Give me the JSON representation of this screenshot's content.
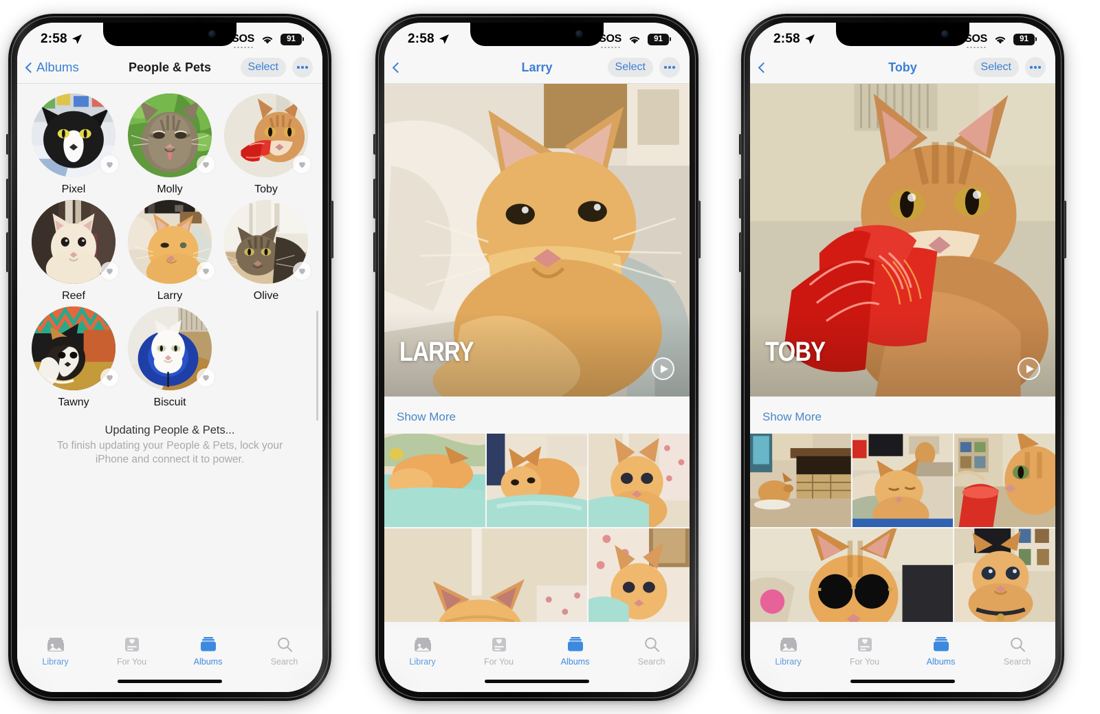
{
  "status_bar": {
    "time": "2:58",
    "sos": "SOS",
    "battery": "91",
    "location_icon": "location-arrow-icon",
    "wifi_icon": "wifi-icon"
  },
  "phones": [
    {
      "id": "phone-people-and-pets",
      "nav": {
        "back_label": "Albums",
        "title": "People & Pets",
        "title_is_link": false,
        "select_label": "Select",
        "more_label": "•••"
      },
      "pets": [
        {
          "name": "Pixel",
          "favorite_icon": "heart-icon"
        },
        {
          "name": "Molly",
          "favorite_icon": "heart-icon"
        },
        {
          "name": "Toby",
          "favorite_icon": "heart-icon"
        },
        {
          "name": "Reef",
          "favorite_icon": "heart-icon"
        },
        {
          "name": "Larry",
          "favorite_icon": "heart-icon"
        },
        {
          "name": "Olive",
          "favorite_icon": "heart-icon"
        },
        {
          "name": "Tawny",
          "favorite_icon": "heart-icon"
        },
        {
          "name": "Biscuit",
          "favorite_icon": "heart-icon"
        }
      ],
      "status": {
        "title": "Updating People & Pets...",
        "subtitle": "To finish updating your People & Pets, lock your iPhone and connect it to power."
      }
    },
    {
      "id": "phone-larry",
      "nav": {
        "back_label": "",
        "title": "Larry",
        "title_is_link": true,
        "select_label": "Select",
        "more_label": "•••"
      },
      "hero": {
        "overlay_title": "LARRY",
        "play_icon": "play-circle-icon"
      },
      "show_more": "Show More",
      "thumbnails": [
        {
          "name": "kitten-sleeping-with-toys"
        },
        {
          "name": "kitten-on-teal-blanket"
        },
        {
          "name": "kitten-sitting-upright"
        },
        {
          "name": "kitten-close-up-ears"
        },
        {
          "name": "kitten-on-floral-blanket"
        }
      ]
    },
    {
      "id": "phone-toby",
      "nav": {
        "back_label": "",
        "title": "Toby",
        "title_is_link": true,
        "select_label": "Select",
        "more_label": "•••"
      },
      "hero": {
        "overlay_title": "TOBY",
        "play_icon": "play-circle-icon"
      },
      "show_more": "Show More",
      "thumbnails": [
        {
          "name": "cat-by-tv-stand"
        },
        {
          "name": "cat-sleepy-on-lap"
        },
        {
          "name": "cat-profile-in-living-room"
        },
        {
          "name": "cat-wearing-sunglasses"
        },
        {
          "name": "cat-with-collar-close-up"
        }
      ]
    }
  ],
  "tab_bar": {
    "items": [
      {
        "label": "Library",
        "icon": "photo-stack-icon",
        "state": "blue-label"
      },
      {
        "label": "For You",
        "icon": "for-you-card-icon",
        "state": "dim"
      },
      {
        "label": "Albums",
        "icon": "albums-icon",
        "state": "active"
      },
      {
        "label": "Search",
        "icon": "search-icon",
        "state": "dim"
      }
    ]
  },
  "colors": {
    "accent": "#3b8ae0",
    "link": "#3b7fd4",
    "dim": "#b4b4b9",
    "bg": "#f5f5f5",
    "navbar": "#f7f7f7"
  }
}
